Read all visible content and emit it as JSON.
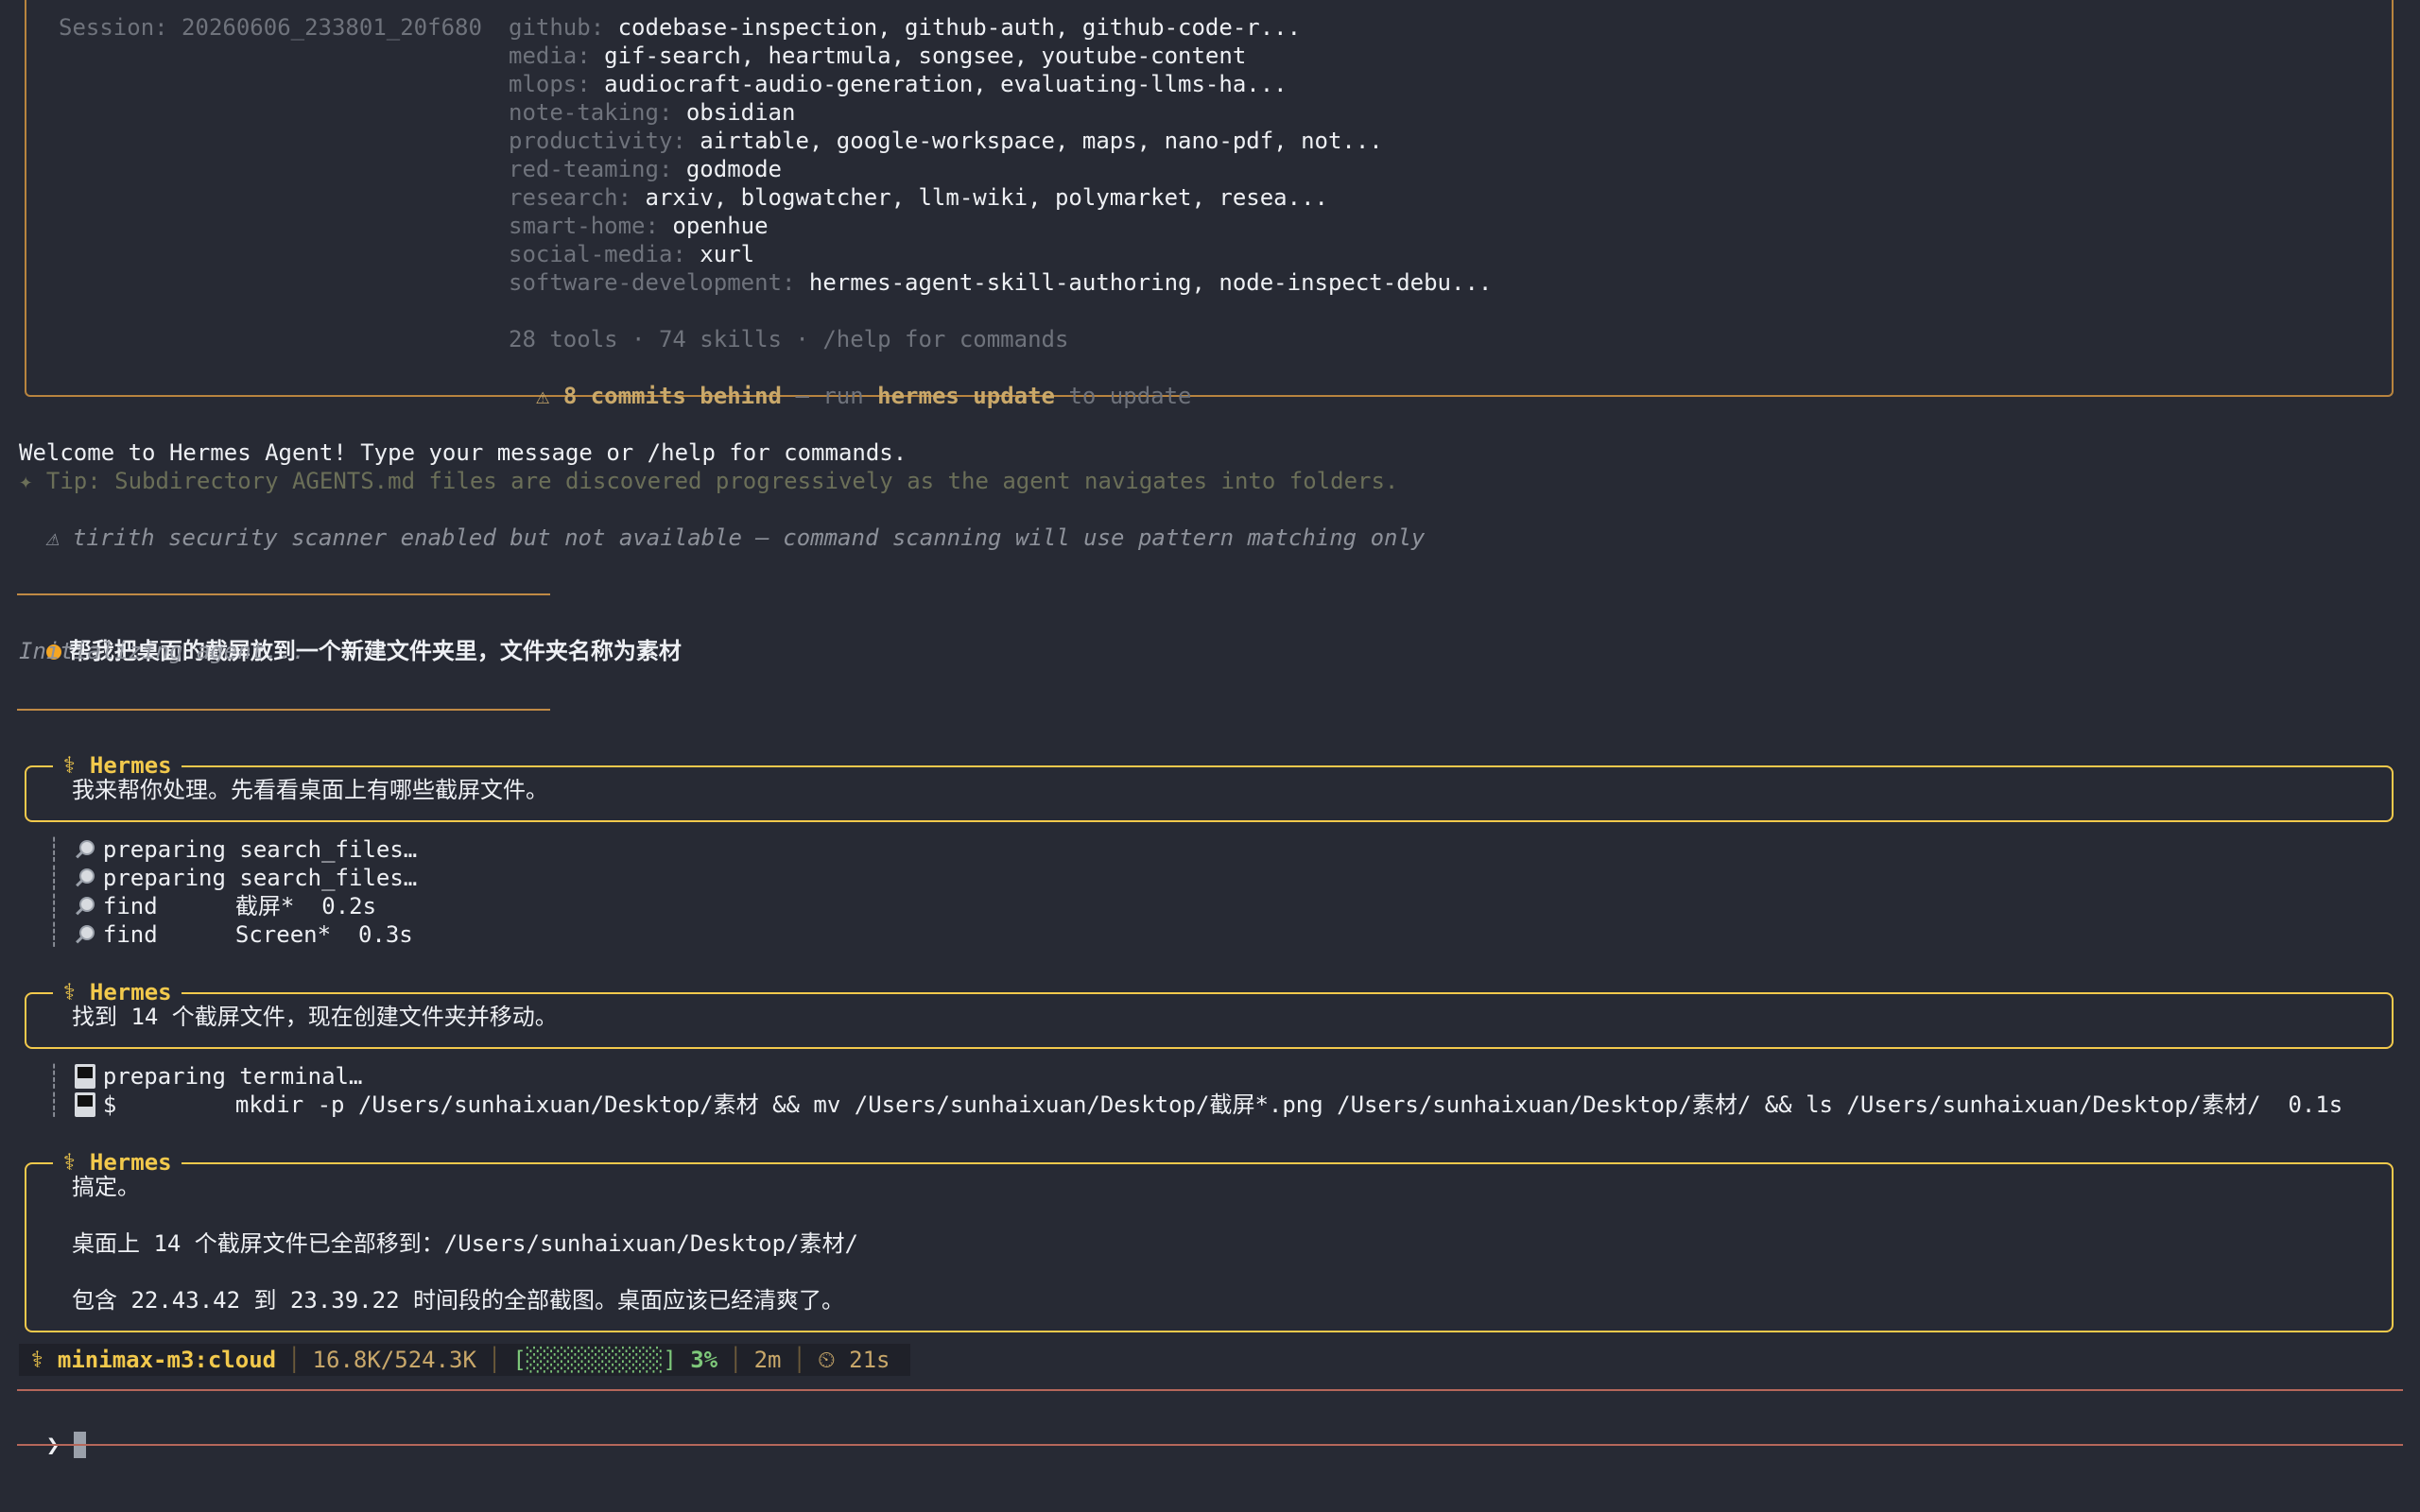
{
  "banner": {
    "session_label": "Session: 20260606_233801_20f680",
    "skills": [
      {
        "category": "github:",
        "items": "codebase-inspection, github-auth, github-code-r..."
      },
      {
        "category": "media:",
        "items": "gif-search, heartmula, songsee, youtube-content"
      },
      {
        "category": "mlops:",
        "items": "audiocraft-audio-generation, evaluating-llms-ha..."
      },
      {
        "category": "note-taking:",
        "items": "obsidian"
      },
      {
        "category": "productivity:",
        "items": "airtable, google-workspace, maps, nano-pdf, not..."
      },
      {
        "category": "red-teaming:",
        "items": "godmode"
      },
      {
        "category": "research:",
        "items": "arxiv, blogwatcher, llm-wiki, polymarket, resea..."
      },
      {
        "category": "smart-home:",
        "items": "openhue"
      },
      {
        "category": "social-media:",
        "items": "xurl"
      },
      {
        "category": "software-development:",
        "items": "hermes-agent-skill-authoring, node-inspect-debu..."
      }
    ],
    "summary": "28 tools · 74 skills · /help for commands",
    "update_warning_icon": "⚠",
    "update_commits": "8 commits behind",
    "update_mid": " — run ",
    "update_cmd": "hermes update",
    "update_tail": " to update"
  },
  "welcome": "Welcome to Hermes Agent! Type your message or /help for commands.",
  "tip": "✦ Tip: Subdirectory AGENTS.md files are discovered progressively as the agent navigates into folders.",
  "security_warning": "⚠ tirith security scanner enabled but not available — command scanning will use pattern matching only",
  "user_message": "帮我把桌面的截屏放到一个新建文件夹里，文件夹名称为素材",
  "initializing": "Initializing agent...",
  "hermes_label": "⚕ Hermes",
  "messages": [
    {
      "text": "我来帮你处理。先看看桌面上有哪些截屏文件。"
    },
    {
      "text": "找到 14 个截屏文件，现在创建文件夹并移动。"
    },
    {
      "lines": [
        "搞定。",
        "",
        "桌面上 14 个截屏文件已全部移到：/Users/sunhaixuan/Desktop/素材/",
        "",
        "包含 22.43.42 到 23.39.22 时间段的全部截图。桌面应该已经清爽了。"
      ]
    }
  ],
  "tools_1": [
    {
      "icon": "magnifier-icon",
      "name": "preparing search_files…",
      "arg": ""
    },
    {
      "icon": "magnifier-icon",
      "name": "preparing search_files…",
      "arg": ""
    },
    {
      "icon": "magnifier-icon",
      "name": "find",
      "arg": "截屏*  0.2s"
    },
    {
      "icon": "magnifier-icon",
      "name": "find",
      "arg": "Screen*  0.3s"
    }
  ],
  "tools_2": [
    {
      "icon": "terminal-icon",
      "name": "preparing terminal…",
      "arg": ""
    },
    {
      "icon": "terminal-icon",
      "name": "$",
      "arg": "mkdir -p /Users/sunhaixuan/Desktop/素材 && mv /Users/sunhaixuan/Desktop/截屏*.png /Users/sunhaixuan/Desktop/素材/ && ls /Users/sunhaixuan/Desktop/素材/  0.1s"
    }
  ],
  "status": {
    "model": "⚕ minimax-m3:cloud",
    "tokens": "16.8K/524.3K",
    "context_bar": "[░░░░░░░░░░]",
    "context_pct": "3%",
    "context_fraction": 0.03,
    "elapsed": "2m",
    "timer": "⏲ 21s"
  },
  "prompt_symbol": "❯"
}
